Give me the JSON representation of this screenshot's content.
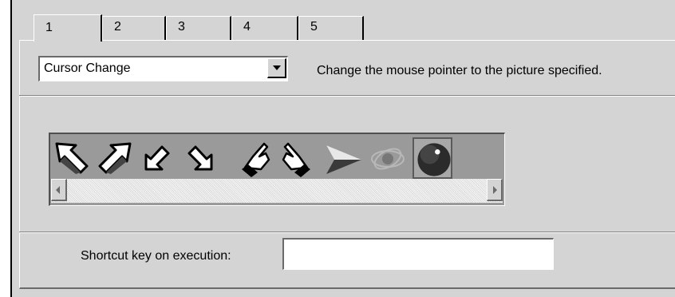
{
  "tabs": [
    {
      "label": "1",
      "active": true
    },
    {
      "label": "2"
    },
    {
      "label": "3"
    },
    {
      "label": "4"
    },
    {
      "label": "5"
    }
  ],
  "action_select": {
    "value": "Cursor Change"
  },
  "description": "Change the mouse pointer to the picture specified.",
  "icons": [
    {
      "name": "arrow-nw-icon"
    },
    {
      "name": "arrow-ne-icon"
    },
    {
      "name": "arrow-sw-icon"
    },
    {
      "name": "arrow-se-icon"
    },
    {
      "name": "hand-point-left-icon"
    },
    {
      "name": "hand-point-right-icon"
    },
    {
      "name": "arrowhead-3d-icon"
    },
    {
      "name": "atom-icon"
    },
    {
      "name": "sphere-icon",
      "selected": true
    }
  ],
  "shortcut": {
    "label": "Shortcut key on execution:",
    "value": ""
  },
  "colors": {
    "dialog": "#d4d4d4",
    "icon_strip": "#9a9a9a"
  }
}
